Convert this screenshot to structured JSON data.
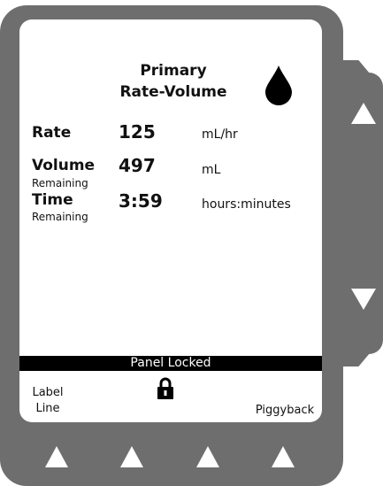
{
  "screen": {
    "title_line1": "Primary",
    "title_line2": "Rate-Volume",
    "rows": [
      {
        "label": "Rate",
        "sub": "",
        "value": "125",
        "unit": "mL/hr"
      },
      {
        "label": "Volume",
        "sub": "Remaining",
        "value": "497",
        "unit": "mL"
      },
      {
        "label": "Time",
        "sub": "Remaining",
        "value": "3:59",
        "unit": "hours:minutes"
      }
    ],
    "status_bar": "Panel Locked",
    "softkeys": {
      "left_line1": "Label",
      "left_line2": "Line",
      "right": "Piggyback"
    }
  },
  "icons": {
    "drop": "drop-icon",
    "lock": "lock-icon",
    "up": "arrow-up-icon",
    "down": "arrow-down-icon"
  },
  "colors": {
    "bezel": "#6e6e6e",
    "screen": "#ffffff",
    "text": "#111111"
  }
}
